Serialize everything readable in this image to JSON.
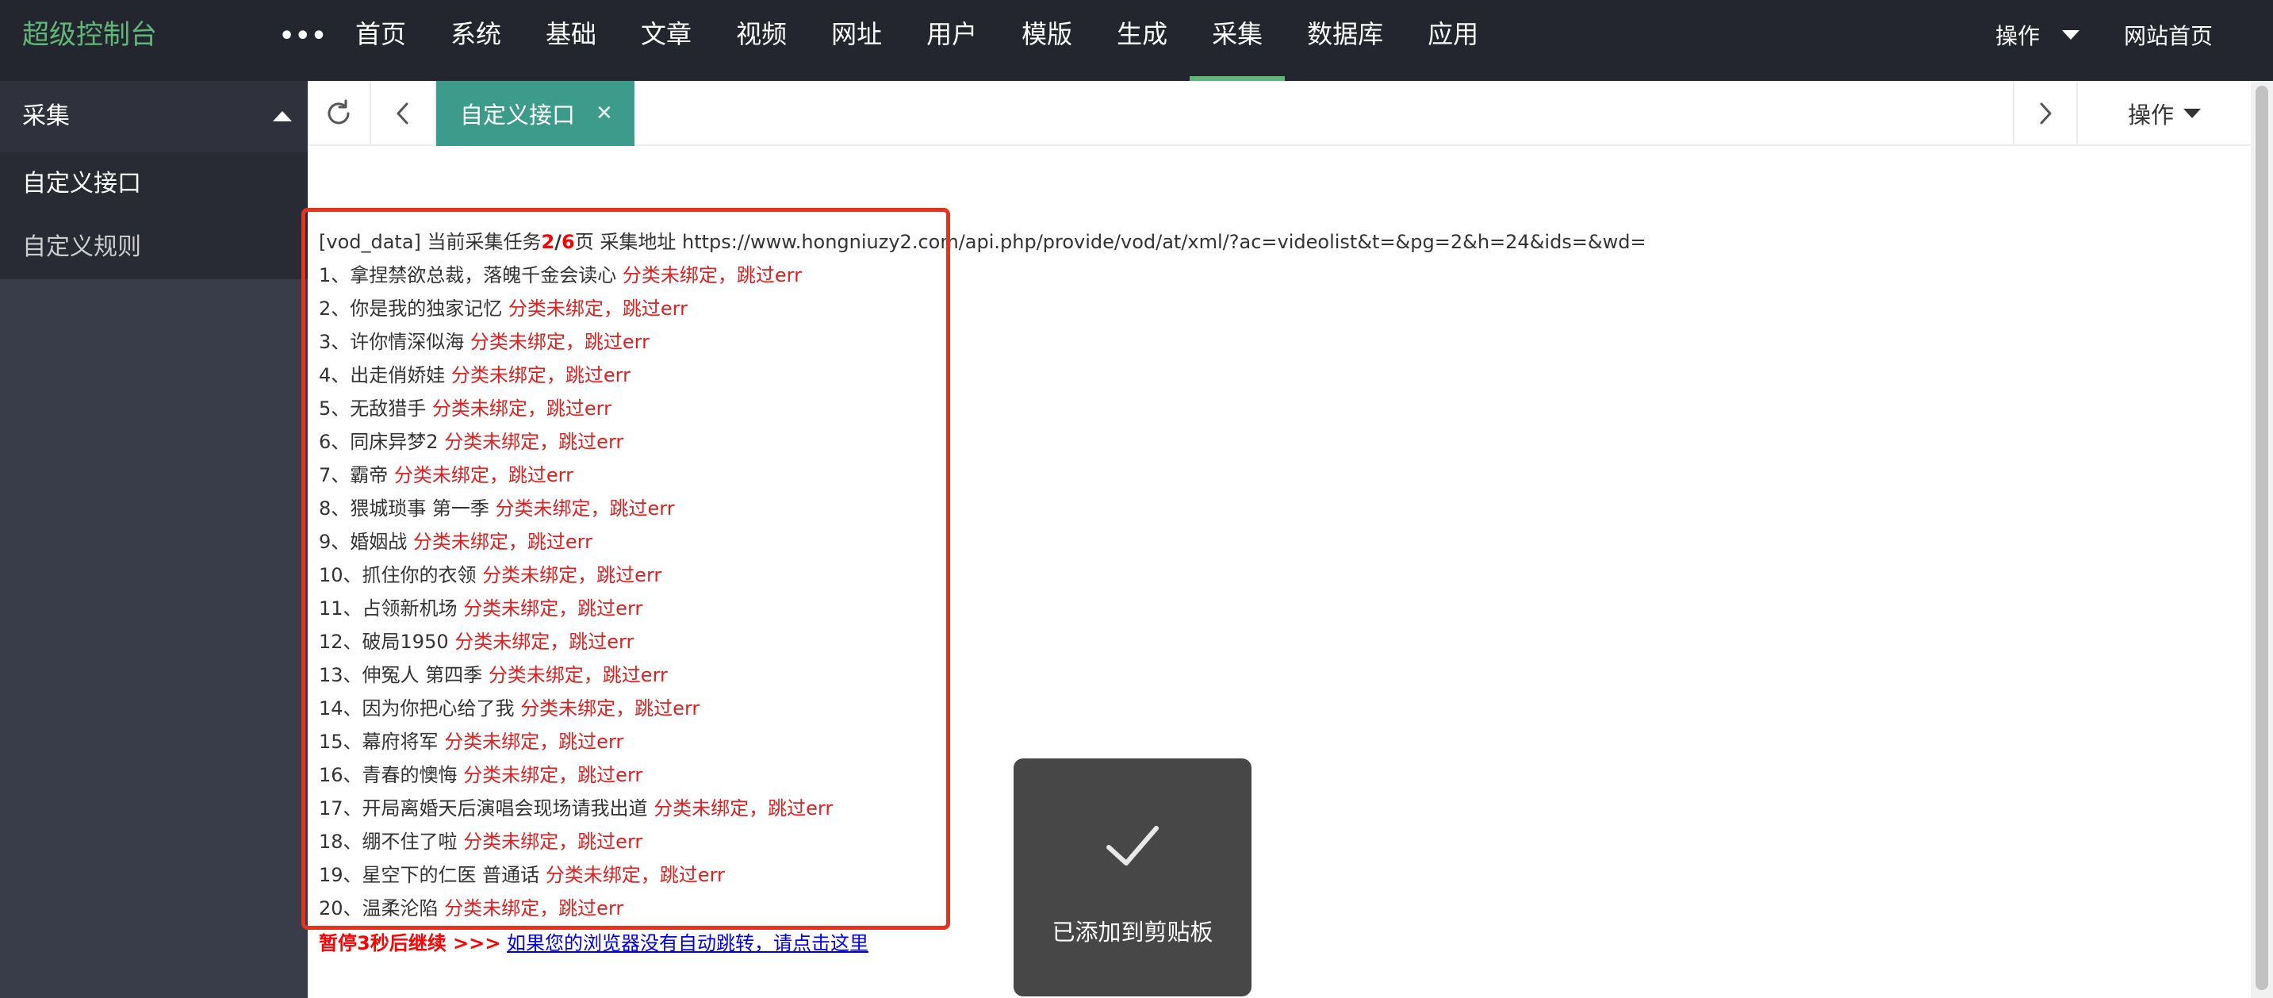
{
  "header": {
    "brand": "超级控制台",
    "more": "•••",
    "nav": [
      "首页",
      "系统",
      "基础",
      "文章",
      "视频",
      "网址",
      "用户",
      "模版",
      "生成",
      "采集",
      "数据库",
      "应用"
    ],
    "active_nav": "采集",
    "ops": "操作",
    "home": "网站首页"
  },
  "sidebar": {
    "group": "采集",
    "items": [
      "自定义接口",
      "自定义规则"
    ]
  },
  "tabs": {
    "active_label": "自定义接口",
    "close": "✕",
    "ops": "操作"
  },
  "log": {
    "head_prefix": "[vod_data] 当前采集任务",
    "current_page": "2",
    "slash": "/",
    "total_pages": "6",
    "head_mid": "页 采集地址 ",
    "url": "https://www.hongniuzy2.com/api.php/provide/vod/at/xml/?ac=videolist&t=&pg=2&h=24&ids=&wd=",
    "error_text": "分类未绑定，跳过err",
    "items": [
      "1、拿捏禁欲总裁，落魄千金会读心",
      "2、你是我的独家记忆",
      "3、许你情深似海",
      "4、出走俏娇娃",
      "5、无敌猎手",
      "6、同床异梦2",
      "7、霸帝",
      "8、猥城琐事 第一季",
      "9、婚姻战",
      "10、抓住你的衣领",
      "11、占领新机场",
      "12、破局1950",
      "13、伸冤人 第四季",
      "14、因为你把心给了我",
      "15、幕府将军",
      "16、青春的懊悔",
      "17、开局离婚天后演唱会现场请我出道",
      "18、绷不住了啦",
      "19、星空下的仁医 普通话",
      "20、温柔沦陷"
    ],
    "pause_text": "暂停3秒后继续 >>>",
    "pause_link": "如果您的浏览器没有自动跳转，请点击这里"
  },
  "toast": {
    "text": "已添加到剪贴板"
  },
  "colors": {
    "topbar": "#23262e",
    "sidebar": "#393d49",
    "accent": "#5fb878",
    "tab_active": "#3d9b8c",
    "error": "#e02020",
    "highlight": "#e8321e"
  }
}
